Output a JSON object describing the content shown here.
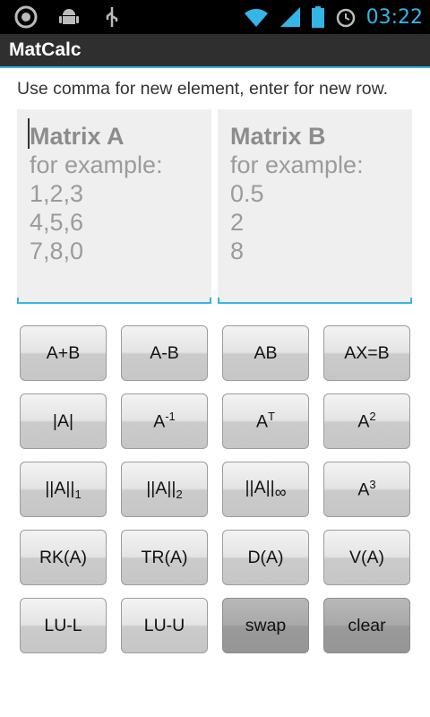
{
  "status_bar": {
    "time": "03:22",
    "icons": [
      "circle-a-icon",
      "android-icon",
      "usb-icon",
      "wifi-icon",
      "signal-icon",
      "battery-icon",
      "alarm-icon"
    ]
  },
  "app": {
    "title": "MatCalc"
  },
  "hint": "Use comma for new element, enter for new row.",
  "matrix_a": {
    "title": "Matrix A",
    "example_label": "for example:",
    "rows": [
      "1,2,3",
      "4,5,6",
      "7,8,0"
    ]
  },
  "matrix_b": {
    "title": "Matrix B",
    "example_label": "for example:",
    "rows": [
      "0.5",
      "2",
      "8"
    ]
  },
  "buttons": {
    "a_plus_b": "A+B",
    "a_minus_b": "A-B",
    "ab": "AB",
    "ax_eq_b": "AX=B",
    "det": "|A|",
    "inverse": {
      "base": "A",
      "sup": "-1"
    },
    "transpose": {
      "base": "A",
      "sup": "T"
    },
    "square": {
      "base": "A",
      "sup": "2"
    },
    "norm1": {
      "base": "||A||",
      "sub": "1"
    },
    "norm2": {
      "base": "||A||",
      "sub": "2"
    },
    "norm_inf": {
      "base": "||A||",
      "sub": "∞"
    },
    "cube": {
      "base": "A",
      "sup": "3"
    },
    "rank": "RK(A)",
    "trace": "TR(A)",
    "d": "D(A)",
    "v": "V(A)",
    "lu_l": "LU-L",
    "lu_u": "LU-U",
    "swap": "swap",
    "clear": "clear"
  },
  "colors": {
    "accent": "#33b5e5",
    "titlebar": "#2f2f2f",
    "input_bg": "#efefef"
  }
}
